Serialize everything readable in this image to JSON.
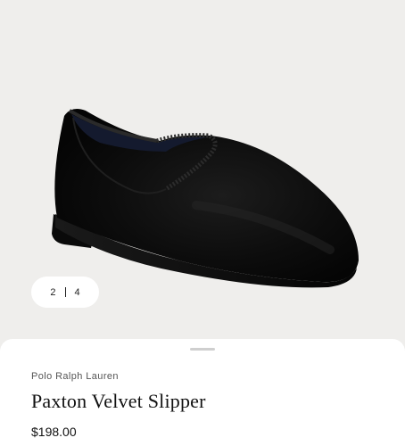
{
  "gallery": {
    "current": "2",
    "total": "4"
  },
  "product": {
    "brand": "Polo Ralph Lauren",
    "name": "Paxton Velvet Slipper",
    "price": "$198.00"
  },
  "colors": {
    "background": "#efeeec",
    "sheet": "#ffffff",
    "text": "#111111",
    "shoe": "#0b0b0b"
  }
}
